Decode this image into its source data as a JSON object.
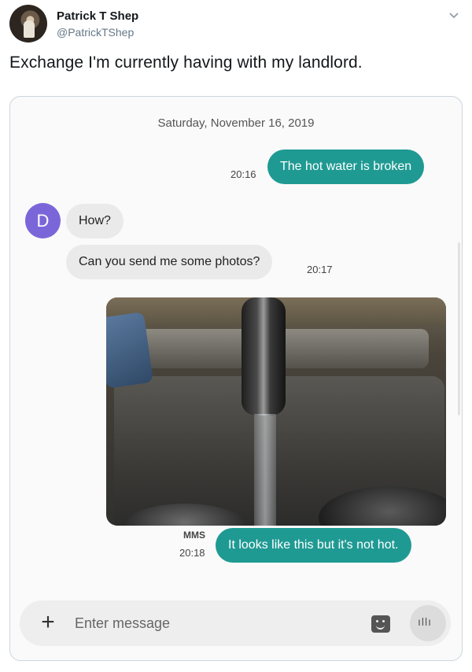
{
  "tweet": {
    "display_name": "Patrick T Shep",
    "handle": "@PatrickTShep",
    "text": "Exchange I'm currently having with my landlord."
  },
  "conversation": {
    "date": "Saturday, November 16, 2019",
    "contact_initial": "D",
    "messages": [
      {
        "direction": "outgoing",
        "text": "The hot water is broken",
        "time": "20:16"
      },
      {
        "direction": "incoming",
        "text": "How?"
      },
      {
        "direction": "incoming",
        "text": "Can you send me some photos?",
        "time": "20:17"
      },
      {
        "direction": "outgoing",
        "type": "image",
        "label": "MMS",
        "text": "It looks like this but it's not hot.",
        "time": "20:18"
      }
    ]
  },
  "composer": {
    "placeholder": "Enter message"
  },
  "icons": {
    "caret": "chevron-down-icon",
    "add": "plus-icon",
    "sticker": "sticker-icon",
    "voice": "voice-waveform-icon"
  },
  "colors": {
    "outgoing_bubble": "#1f9a93",
    "incoming_bubble": "#eaeaea",
    "contact_avatar": "#7b66d9"
  }
}
